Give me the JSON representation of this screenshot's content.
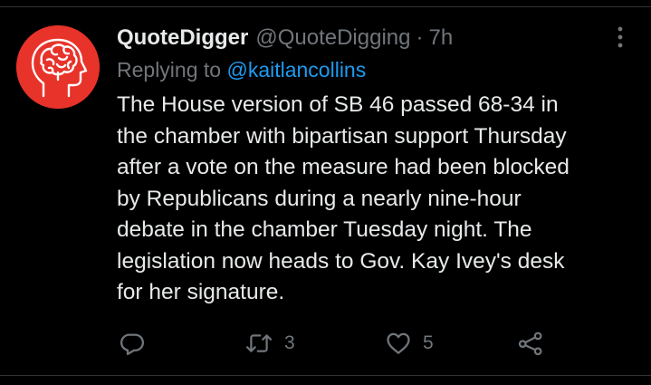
{
  "tweet": {
    "author_name": "QuoteDigger",
    "author_handle": "@QuoteDigging",
    "separator": "·",
    "time_ago": "7h",
    "replying_label": "Replying to",
    "replying_to": "@kaitlancollins",
    "text_lines": [
      "The House version of SB 46 passed 68-34 in",
      "the chamber with bipartisan support Thursday",
      "after a vote on the measure had been blocked",
      "by Republicans during a nearly nine-hour",
      "debate in the chamber Tuesday night. The",
      "legislation now heads to Gov. Kay Ivey's desk",
      "for her signature."
    ]
  },
  "actions": {
    "reply_icon": "reply-icon",
    "retweet_icon": "retweet-icon",
    "retweet_count": "3",
    "like_icon": "heart-icon",
    "like_count": "5",
    "share_icon": "share-icon"
  },
  "colors": {
    "background": "#000000",
    "primary_text": "#e7e9ea",
    "secondary_text": "#71767b",
    "link": "#1d9bf0",
    "avatar_bg": "#e8332a"
  }
}
